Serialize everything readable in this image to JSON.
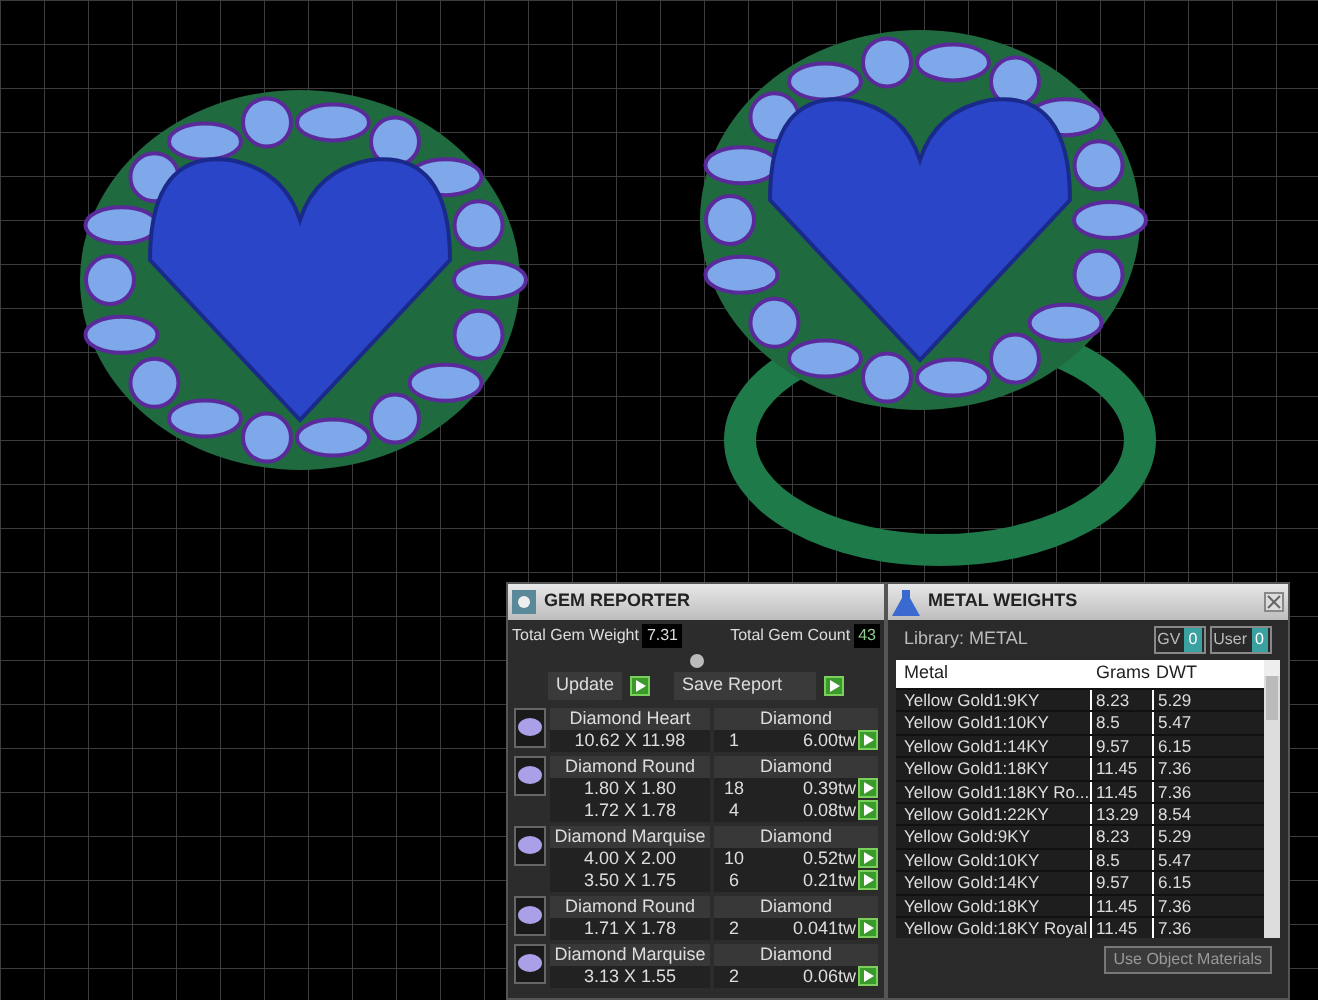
{
  "gem_reporter": {
    "title": "GEM REPORTER",
    "total_weight_label": "Total Gem Weight",
    "total_weight": "7.31",
    "total_count_label": "Total Gem Count",
    "total_count": "43",
    "buttons": [
      "Update",
      "Save Report"
    ],
    "groups": [
      {
        "name": "Diamond Heart",
        "material": "Diamond",
        "rows": [
          {
            "size": "10.62 X 11.98",
            "count": "1",
            "weight": "6.00tw"
          }
        ]
      },
      {
        "name": "Diamond Round",
        "material": "Diamond",
        "rows": [
          {
            "size": "1.80 X 1.80",
            "count": "18",
            "weight": "0.39tw"
          },
          {
            "size": "1.72 X 1.78",
            "count": "4",
            "weight": "0.08tw"
          }
        ]
      },
      {
        "name": "Diamond Marquise",
        "material": "Diamond",
        "rows": [
          {
            "size": "4.00 X 2.00",
            "count": "10",
            "weight": "0.52tw"
          },
          {
            "size": "3.50 X 1.75",
            "count": "6",
            "weight": "0.21tw"
          }
        ]
      },
      {
        "name": "Diamond Round",
        "material": "Diamond",
        "rows": [
          {
            "size": "1.71 X 1.78",
            "count": "2",
            "weight": "0.041tw"
          }
        ]
      },
      {
        "name": "Diamond Marquise",
        "material": "Diamond",
        "rows": [
          {
            "size": "3.13 X 1.55",
            "count": "2",
            "weight": "0.06tw"
          }
        ]
      }
    ]
  },
  "metal_weights": {
    "title": "METAL WEIGHTS",
    "library": "Library: METAL",
    "toggles": [
      {
        "label": "GV",
        "value": "0"
      },
      {
        "label": "User",
        "value": "0"
      }
    ],
    "columns": [
      "Metal",
      "Grams",
      "DWT"
    ],
    "rows": [
      [
        "Yellow Gold1:9KY",
        "8.23",
        "5.29"
      ],
      [
        "Yellow Gold1:10KY",
        "8.5",
        "5.47"
      ],
      [
        "Yellow Gold1:14KY",
        "9.57",
        "6.15"
      ],
      [
        "Yellow Gold1:18KY",
        "11.45",
        "7.36"
      ],
      [
        "Yellow Gold1:18KY Ro...",
        "11.45",
        "7.36"
      ],
      [
        "Yellow Gold1:22KY",
        "13.29",
        "8.54"
      ],
      [
        "Yellow Gold:9KY",
        "8.23",
        "5.29"
      ],
      [
        "Yellow Gold:10KY",
        "8.5",
        "5.47"
      ],
      [
        "Yellow Gold:14KY",
        "9.57",
        "6.15"
      ],
      [
        "Yellow Gold:18KY",
        "11.45",
        "7.36"
      ],
      [
        "Yellow Gold:18KY Royal",
        "11.45",
        "7.36"
      ]
    ],
    "footer_button": "Use Object Materials"
  }
}
